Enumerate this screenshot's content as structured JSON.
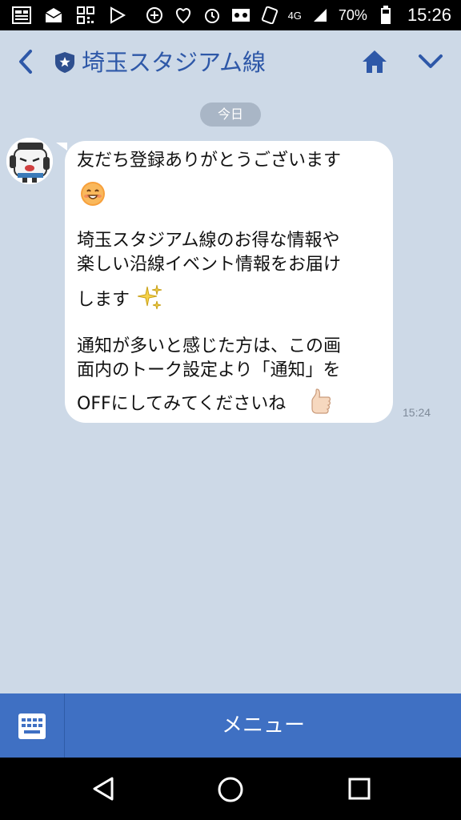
{
  "status_bar": {
    "battery_percent": "70%",
    "network": "4G",
    "time": "15:26",
    "left_icons": [
      "news-icon",
      "mail-icon",
      "qr-code-icon",
      "play-store-icon"
    ],
    "right_icons": [
      "data-saver-icon",
      "heart-signal-icon",
      "alarm-icon",
      "voicemail-icon",
      "nfc-icon",
      "signal-icon",
      "battery-icon"
    ]
  },
  "header": {
    "title": "埼玉スタジアム線"
  },
  "chat": {
    "date_label": "今日",
    "message_lines": [
      "友だち登録ありがとうございます",
      "",
      "埼玉スタジアム線のお得な情報や",
      "楽しい沿線イベント情報をお届け",
      "します",
      "通知が多いと感じた方は、この画",
      "面内のトーク設定より「通知」を",
      "OFFにしてみてくださいね"
    ],
    "emojis": [
      "smile-emoji",
      "sparkles-emoji",
      "thumbs-up-emoji"
    ],
    "time": "15:24"
  },
  "bottom_bar": {
    "menu_label": "メニュー"
  },
  "colors": {
    "background": "#cdd9e7",
    "accent": "#2e58a8",
    "menu_bar": "#3f70c3",
    "bubble": "#ffffff"
  }
}
